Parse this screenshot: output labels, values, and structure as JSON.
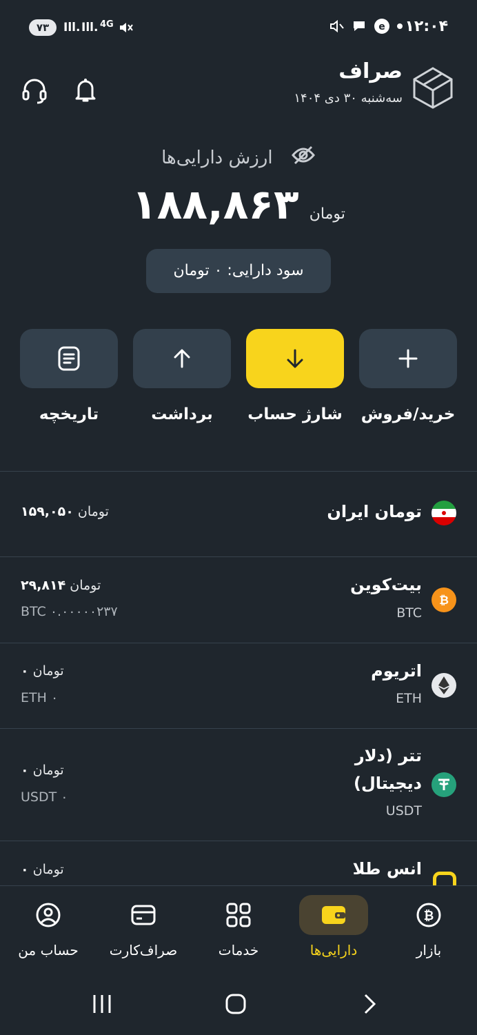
{
  "status_bar": {
    "battery": "۷۳",
    "signal_1": "Ill.",
    "signal_2": "Ill.",
    "network": "4G",
    "time": "۱۲:۰۴"
  },
  "header": {
    "brand_name": "صراف",
    "date": "سه‌شنبه ۳۰ دی ۱۴۰۴"
  },
  "balance": {
    "label": "ارزش دارایی‌ها",
    "amount": "۱۸۸,۸۶۳",
    "currency": "تومان",
    "profit": "سود دارایی: ۰ تومان"
  },
  "actions": [
    {
      "label": "خرید/فروش",
      "icon": "plus-icon"
    },
    {
      "label": "شارژ حساب",
      "icon": "arrow-down-icon"
    },
    {
      "label": "برداشت",
      "icon": "arrow-up-icon"
    },
    {
      "label": "تاریخچه",
      "icon": "document-icon"
    }
  ],
  "assets": [
    {
      "name": "تومان ایران",
      "symbol": "",
      "value": "۱۵۹,۰۵۰",
      "unit": "تومان",
      "amount": "",
      "icon": "iran-flag-icon"
    },
    {
      "name": "بیت‌کوین",
      "symbol": "BTC",
      "value": "۲۹,۸۱۴",
      "unit": "تومان",
      "amount": "BTC ۰.۰۰۰۰۰۲۳۷",
      "icon": "bitcoin-icon",
      "color": "#f7931a"
    },
    {
      "name": "اتریوم",
      "symbol": "ETH",
      "value": "۰",
      "unit": "تومان",
      "amount": "ETH ۰",
      "icon": "ethereum-icon"
    },
    {
      "name_line1": "تتر (دلار",
      "name_line2": "دیجیتال)",
      "symbol": "USDT",
      "value": "۰",
      "unit": "تومان",
      "amount": "USDT ۰",
      "icon": "tether-icon",
      "color": "#26a17b"
    },
    {
      "name": "انس طلا",
      "value": "۰",
      "unit": "تومان",
      "icon": "gold-icon"
    }
  ],
  "nav": [
    {
      "label": "بازار",
      "icon": "bitcoin-circle-icon"
    },
    {
      "label": "دارایی‌ها",
      "icon": "wallet-icon",
      "active": true
    },
    {
      "label": "خدمات",
      "icon": "grid-icon"
    },
    {
      "label": "صراف‌کارت",
      "icon": "card-icon"
    },
    {
      "label": "حساب من",
      "icon": "user-icon"
    }
  ],
  "colors": {
    "background": "#1f262d",
    "surface": "#33404c",
    "accent": "#f8d41c"
  }
}
